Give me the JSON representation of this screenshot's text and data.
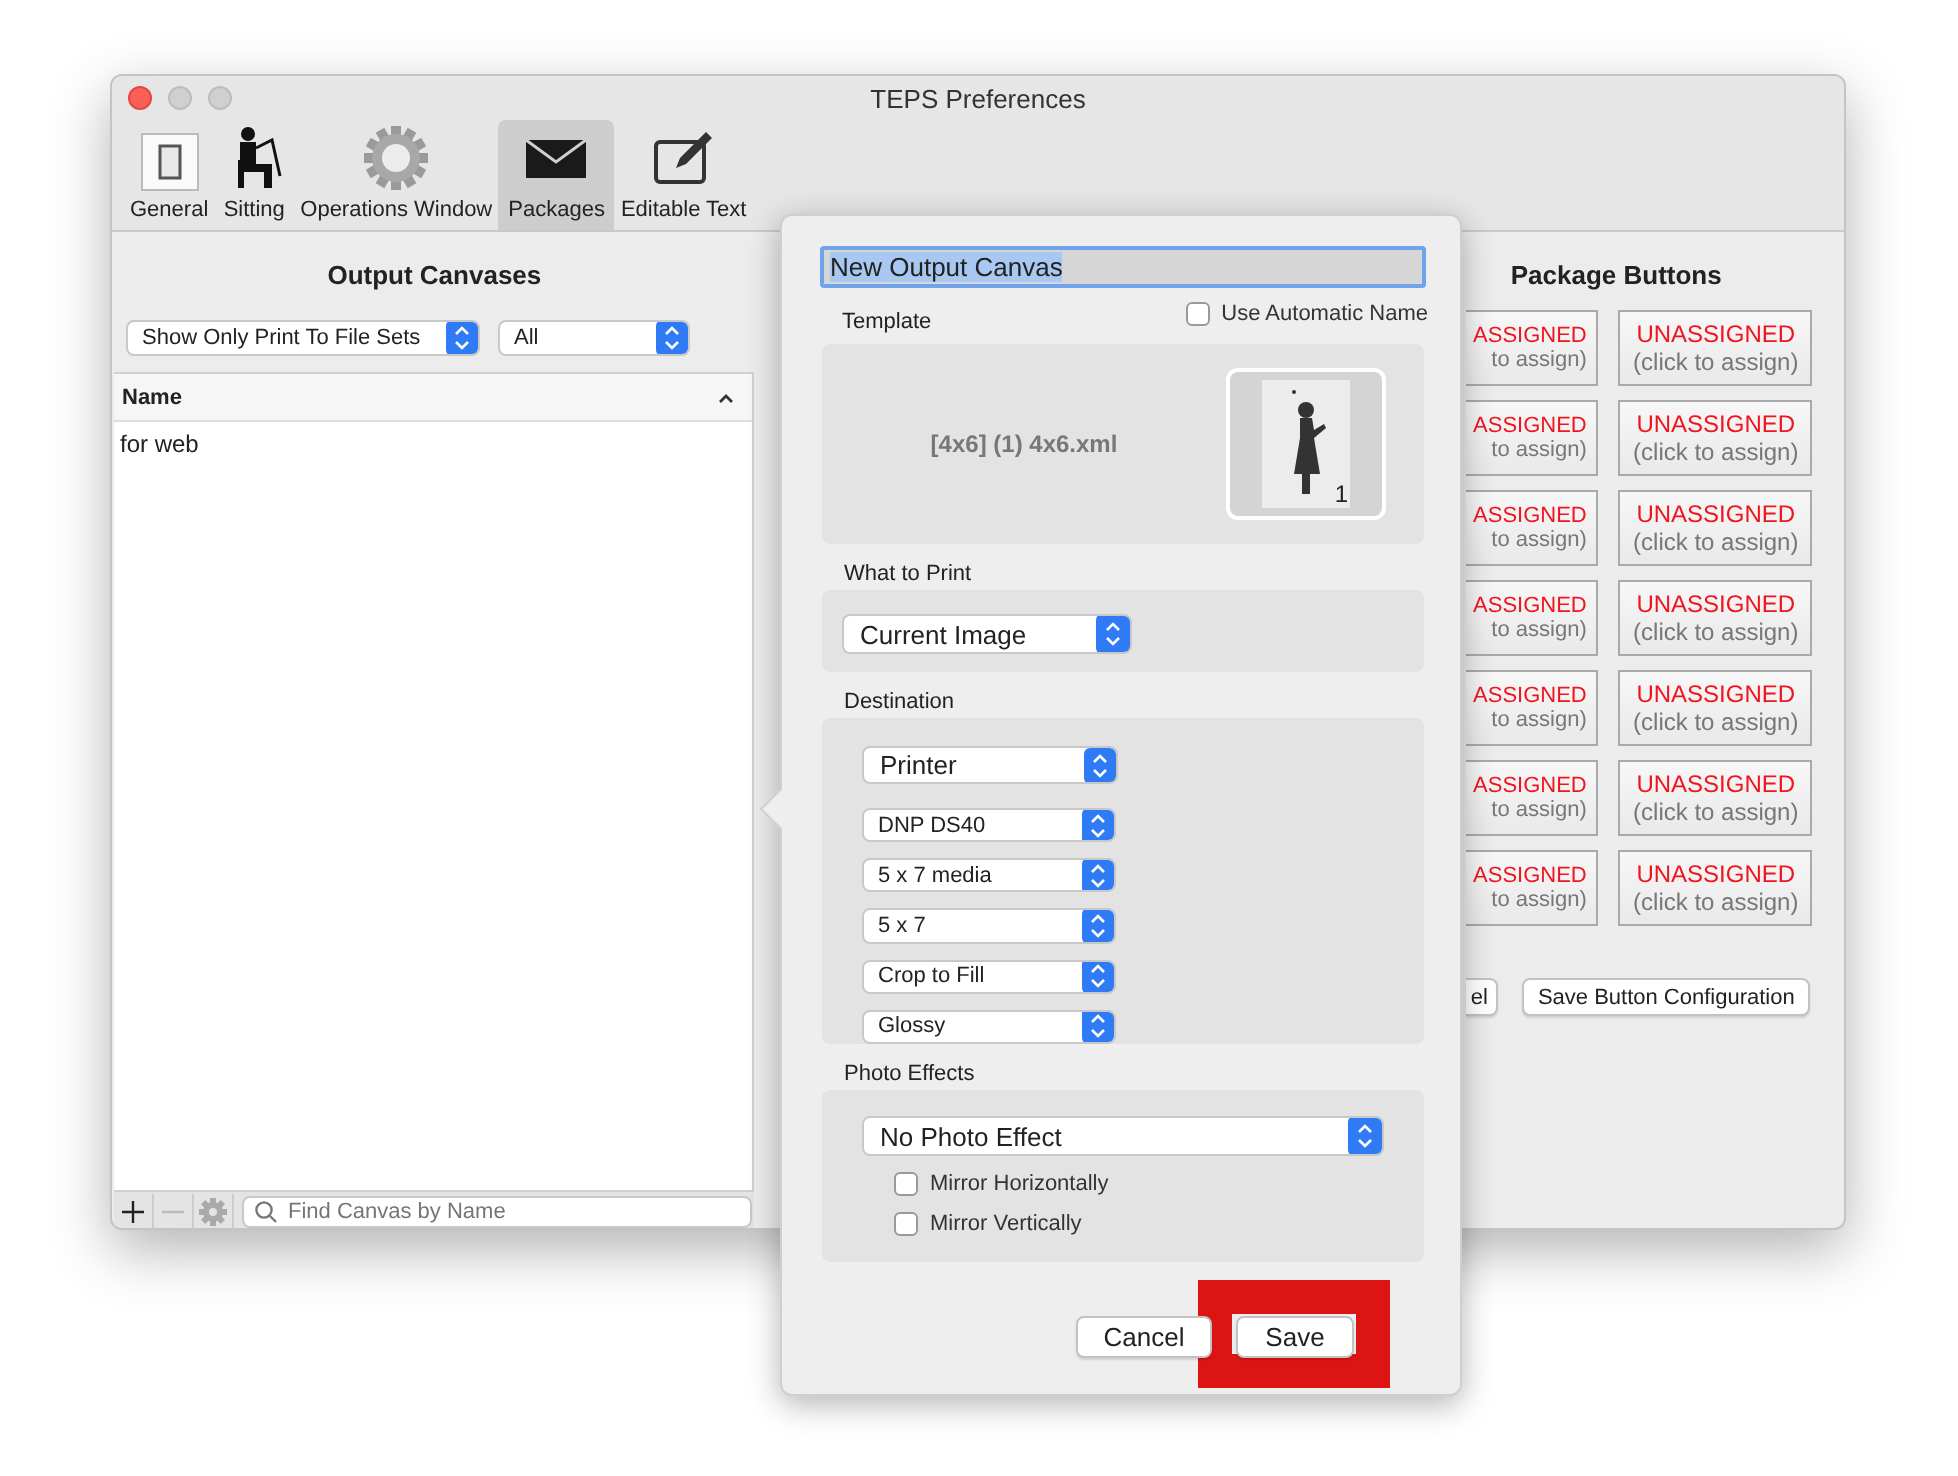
{
  "window": {
    "title": "TEPS Preferences"
  },
  "toolbar": [
    {
      "label": "General",
      "kind": "switch",
      "selected": false
    },
    {
      "label": "Sitting",
      "kind": "figure",
      "selected": false
    },
    {
      "label": "Operations Window",
      "kind": "gear",
      "selected": false
    },
    {
      "label": "Packages",
      "kind": "envelope",
      "selected": true
    },
    {
      "label": "Editable Text",
      "kind": "edit",
      "selected": false
    }
  ],
  "output_canvases": {
    "title": "Output Canvases",
    "filter_popup": "Show Only Print To File Sets",
    "type_popup": "All",
    "table": {
      "columns": [
        "Name"
      ],
      "rows": [
        "for web"
      ]
    },
    "search": {
      "placeholder": "Find Canvas by Name"
    }
  },
  "package_buttons": {
    "title": "Package Buttons",
    "rows": [
      {
        "left": {
          "label": "ASSIGNED",
          "hint": "to assign)"
        },
        "right": {
          "label": "UNASSIGNED",
          "hint": "(click to assign)"
        }
      },
      {
        "left": {
          "label": "ASSIGNED",
          "hint": "to assign)"
        },
        "right": {
          "label": "UNASSIGNED",
          "hint": "(click to assign)"
        }
      },
      {
        "left": {
          "label": "ASSIGNED",
          "hint": "to assign)"
        },
        "right": {
          "label": "UNASSIGNED",
          "hint": "(click to assign)"
        }
      },
      {
        "left": {
          "label": "ASSIGNED",
          "hint": "to assign)"
        },
        "right": {
          "label": "UNASSIGNED",
          "hint": "(click to assign)"
        }
      },
      {
        "left": {
          "label": "ASSIGNED",
          "hint": "to assign)"
        },
        "right": {
          "label": "UNASSIGNED",
          "hint": "(click to assign)"
        }
      },
      {
        "left": {
          "label": "ASSIGNED",
          "hint": "to assign)"
        },
        "right": {
          "label": "UNASSIGNED",
          "hint": "(click to assign)"
        }
      },
      {
        "left": {
          "label": "ASSIGNED",
          "hint": "to assign)"
        },
        "right": {
          "label": "UNASSIGNED",
          "hint": "(click to assign)"
        }
      }
    ],
    "cancel_partial": "el",
    "save_button": "Save Button Configuration"
  },
  "popover": {
    "name_field": {
      "value": "New Output Canvas"
    },
    "template": {
      "label": "Template",
      "use_automatic_name": {
        "label": "Use Automatic Name",
        "checked": false
      },
      "file": "[4x6] (1) 4x6.xml",
      "thumbnail_number": "1"
    },
    "what_to_print": {
      "label": "What to Print",
      "value": "Current Image"
    },
    "destination": {
      "label": "Destination",
      "popups": [
        "Printer",
        "DNP DS40",
        "5 x 7 media",
        "5 x 7",
        "Crop to Fill",
        "Glossy"
      ]
    },
    "photo_effects": {
      "label": "Photo Effects",
      "value": "No Photo Effect",
      "checks": [
        {
          "label": "Mirror Horizontally",
          "checked": false
        },
        {
          "label": "Mirror Vertically",
          "checked": false
        }
      ]
    },
    "buttons": {
      "cancel": "Cancel",
      "save": "Save"
    }
  }
}
